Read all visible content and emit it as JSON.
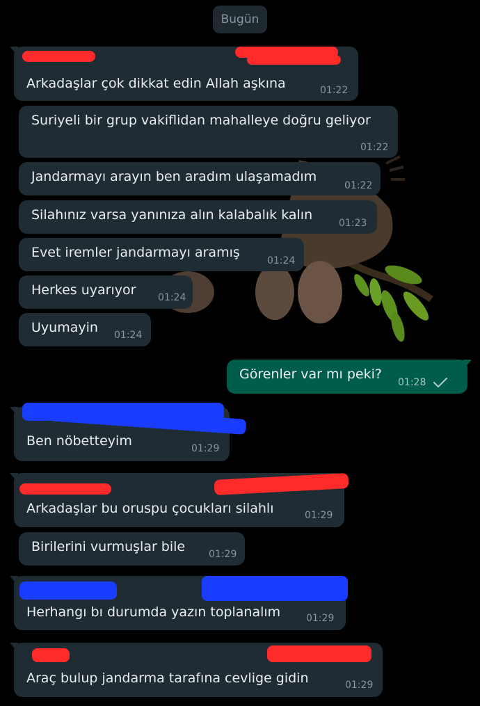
{
  "date_separator": "Bugün",
  "messages": [
    {
      "text": "Arkadaşlar çok dikkat edin Allah aşkına",
      "time": "01:22"
    },
    {
      "text": "Suriyeli bir grup vakiflidan mahalleye doğru geliyor",
      "time": "01:22"
    },
    {
      "text": "Jandarmayı arayın ben aradım ulaşamadım",
      "time": "01:22"
    },
    {
      "text": "Silahınız varsa yanınıza alın kalabalık kalın",
      "time": "01:23"
    },
    {
      "text": "Evet iremler jandarmayı aramış",
      "time": "01:24"
    },
    {
      "text": "Herkes uyarıyor",
      "time": "01:24"
    },
    {
      "text": "Uyumayin",
      "time": "01:24"
    },
    {
      "text": "Görenler var mı peki?",
      "time": "01:28"
    },
    {
      "text": "Ben nöbetteyim",
      "time": "01:29"
    },
    {
      "text": "Arkadaşlar bu oruspu çocukları silahlı",
      "time": "01:29"
    },
    {
      "text": "Birilerini vurmuşlar bile",
      "time": "01:29"
    },
    {
      "text": "Herhangı bı durumda yazın toplanalım",
      "time": "01:29"
    },
    {
      "text": "Araç bulup jandarma tarafına cevlige gidin",
      "time": "01:29"
    }
  ],
  "colors": {
    "background": "#000000",
    "incoming_bubble": "#1f2c33",
    "outgoing_bubble": "#005c4b",
    "redaction_red": "#ff2a2a",
    "redaction_blue": "#1a3cff"
  },
  "icons": {
    "read_receipt": "check-icon"
  }
}
